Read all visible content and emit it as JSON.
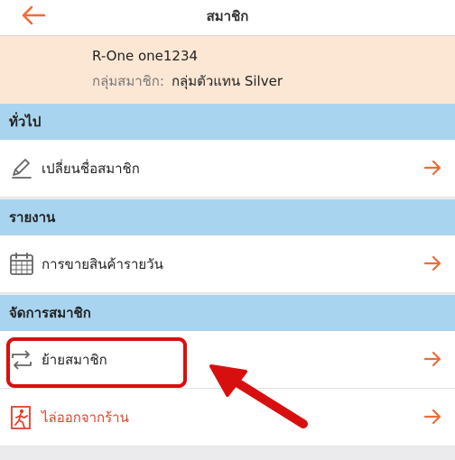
{
  "header": {
    "title": "สมาชิก"
  },
  "profile": {
    "name": "R-One one1234",
    "group_label": "กลุ่มสมาชิก:",
    "group_value": "กลุ่มตัวแทน Silver"
  },
  "sections": [
    {
      "title": "ทั่วไป",
      "items": [
        {
          "label": "เปลี่ยนชื่อสมาชิก",
          "icon": "edit-icon"
        }
      ]
    },
    {
      "title": "รายงาน",
      "items": [
        {
          "label": "การขายสินค้ารายวัน",
          "icon": "calendar-icon"
        }
      ]
    },
    {
      "title": "จัดการสมาชิก",
      "items": [
        {
          "label": "ย้ายสมาชิก",
          "icon": "transfer-icon"
        },
        {
          "label": "ไล่ออกจากร้าน",
          "icon": "exit-icon"
        }
      ]
    }
  ],
  "colors": {
    "accent": "#ef6b3b",
    "section_header": "#a9d4ef",
    "profile_bg": "#fce6d4",
    "danger": "#e0412a",
    "annotation": "#d80f0f"
  }
}
